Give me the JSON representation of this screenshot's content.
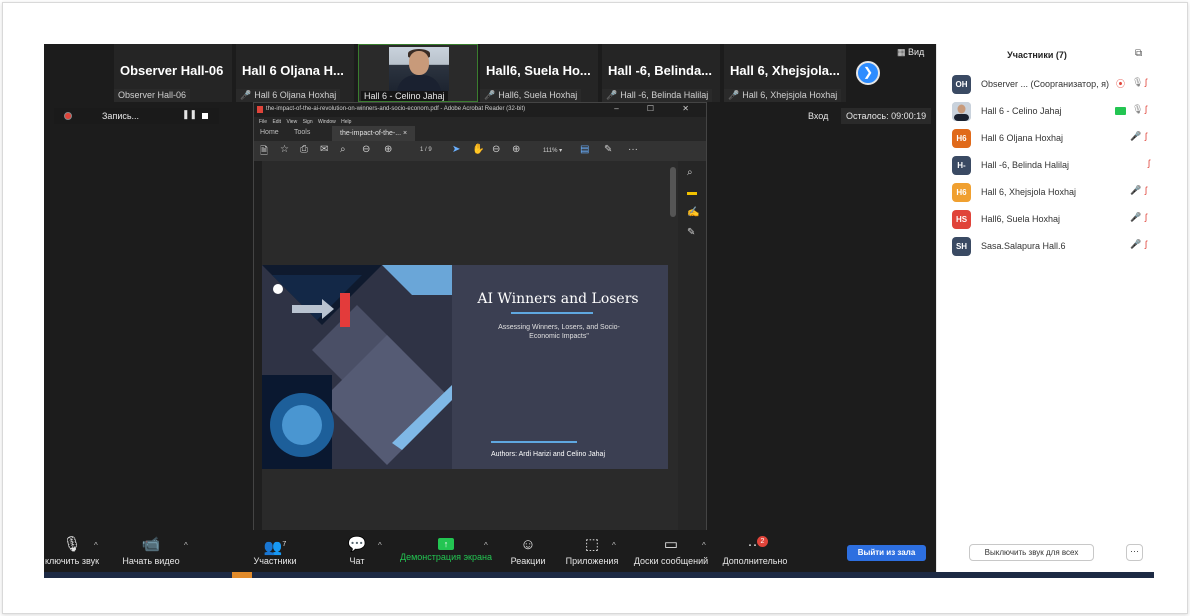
{
  "thumbnails": {
    "tiles": [
      {
        "name": "Observer  Hall-06",
        "sub": "Observer  Hall-06"
      },
      {
        "name": "Hall 6 Oljana H...",
        "sub": "Hall 6 Oljana Hoxhaj"
      },
      {
        "name": "",
        "sub": "Hall 6 - Celino Jahaj"
      },
      {
        "name": "Hall6, Suela Ho...",
        "sub": "Hall6, Suela Hoxhaj"
      },
      {
        "name": "Hall -6, Belinda...",
        "sub": "Hall -6, Belinda Halilaj"
      },
      {
        "name": "Hall 6, Xhejsjola...",
        "sub": "Hall 6, Xhejsjola Hoxhaj"
      }
    ],
    "next_arrow": "❯",
    "view_label": "Вид"
  },
  "recording": {
    "label": "Запись...",
    "pause": "❚❚"
  },
  "enter_label": "Вход",
  "time_remaining": "Осталось: 09:00:19",
  "acrobat": {
    "window_title": "the-impact-of-the-ai-revolution-on-winners-and-socio-econom.pdf - Adobe Acrobat Reader (32-bit)",
    "window_buttons": "– ☐ ✕",
    "menu": "File Edit View Sign Window Help",
    "tabs": {
      "home": "Home",
      "tools": "Tools",
      "document": "the-impact-of-the-... ×"
    },
    "page_indicator": "1  /  9",
    "zoom": "111%  ▾"
  },
  "slide": {
    "title": "AI Winners and Losers",
    "subtitle": "Assessing Winners, Losers, and Socio-Economic Impacts\"",
    "authors": "Authors: Ardi Harizi and Celino Jahaj"
  },
  "toolbar": {
    "mute": "ключить звук",
    "video": "Начать видео",
    "participants": "Участники",
    "participants_count": "7",
    "chat": "Чат",
    "share": "Демонстрация экрана",
    "reactions": "Реакции",
    "apps": "Приложения",
    "whiteboards": "Доски сообщений",
    "more": "Дополнительно",
    "more_badge": "2",
    "leave": "Выйти из зала"
  },
  "panel": {
    "title": "Участники (7)",
    "participants": [
      {
        "initials": "OH",
        "name": "Observer ... (Соорганизатор, я)",
        "color": "#3a4a63"
      },
      {
        "initials": "",
        "name": "Hall 6 - Celino Jahaj",
        "color": "#5a6b80"
      },
      {
        "initials": "H6",
        "name": "Hall 6 Oljana Hoxhaj",
        "color": "#e06a1b"
      },
      {
        "initials": "H-",
        "name": "Hall -6, Belinda Halilaj",
        "color": "#3a4a63"
      },
      {
        "initials": "H6",
        "name": "Hall 6, Xhejsjola Hoxhaj",
        "color": "#f0a030"
      },
      {
        "initials": "HS",
        "name": "Hall6, Suela Hoxhaj",
        "color": "#e0443a"
      },
      {
        "initials": "SH",
        "name": "Sasa.Salapura Hall.6",
        "color": "#3a4a63"
      }
    ],
    "unmute_all": "Выключить звук для всех",
    "more": "···"
  }
}
